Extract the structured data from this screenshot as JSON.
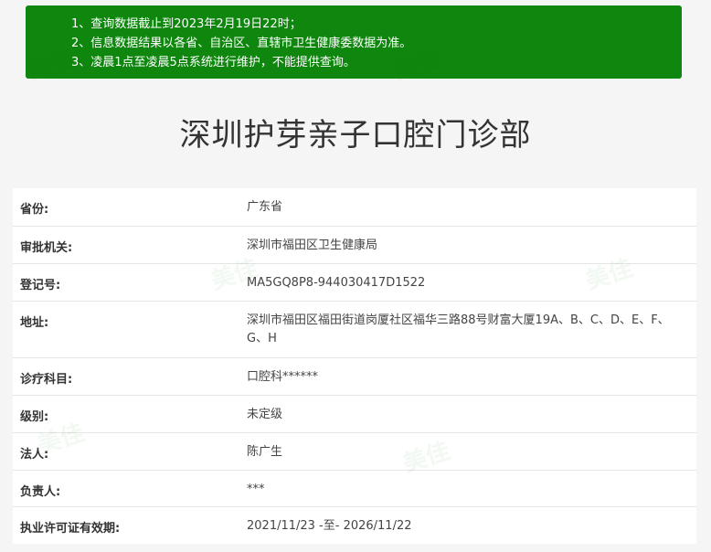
{
  "notice": {
    "lines": [
      "1、查询数据截止到2023年2月19日22时；",
      "2、信息数据结果以各省、自治区、直辖市卫生健康委数据为准。",
      "3、凌晨1点至凌晨5点系统进行维护，不能提供查询。"
    ]
  },
  "page_title": "深圳护芽亲子口腔门诊部",
  "info_rows": [
    {
      "label": "省份:",
      "value": "广东省"
    },
    {
      "label": "审批机关:",
      "value": "深圳市福田区卫生健康局"
    },
    {
      "label": "登记号:",
      "value": "MA5GQ8P8-944030417D1522"
    },
    {
      "label": "地址:",
      "value": "深圳市福田区福田街道岗厦社区福华三路88号财富大厦19A、B、C、D、E、F、G、H"
    },
    {
      "label": "诊疗科目:",
      "value": "口腔科******"
    },
    {
      "label": "级别:",
      "value": "未定级"
    },
    {
      "label": "法人:",
      "value": "陈广生"
    },
    {
      "label": "负责人:",
      "value": "***"
    },
    {
      "label": "执业许可证有效期:",
      "value": "2021/11/23 -至- 2026/11/22"
    }
  ],
  "watermark": {
    "text": "美佳"
  }
}
